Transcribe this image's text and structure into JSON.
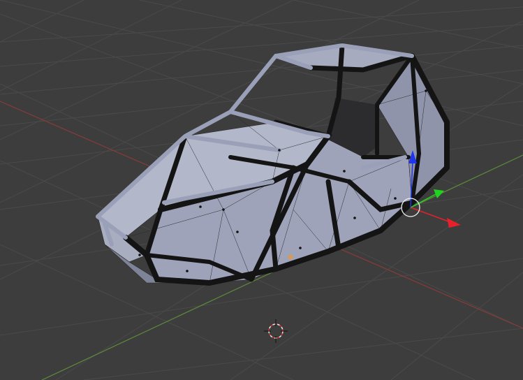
{
  "viewport": {
    "background": "#3d3d3d",
    "grid_color": "#4a4a4a",
    "x_axis_color": "#8b3a3a",
    "y_axis_color": "#5e8c3a"
  },
  "gizmo": {
    "x_color": "#e8202a",
    "y_color": "#1fd41f",
    "z_color": "#2036e8",
    "icon": "transform-manipulator-icon"
  },
  "model": {
    "tube_color": "#1a1a1a",
    "panel_color": "#b8bccf",
    "selected_edge_color": "#9aa0b8"
  },
  "cursor": {
    "icon": "3d-cursor-icon"
  }
}
